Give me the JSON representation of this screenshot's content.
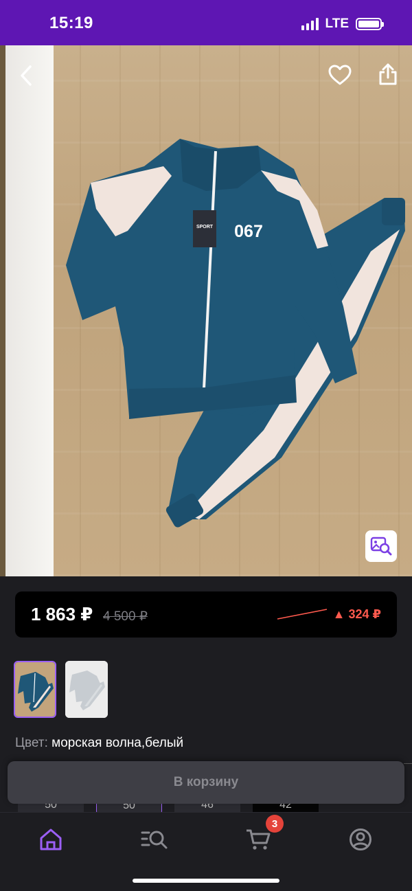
{
  "status_bar": {
    "time": "15:19",
    "network": "LTE"
  },
  "product": {
    "price_current": "1 863 ₽",
    "price_old": "4 500 ₽",
    "price_diff": "▲ 324 ₽",
    "tag_brand": "SPORT",
    "jacket_number": "067",
    "color_label": "Цвет:",
    "color_value": "морская волна,белый"
  },
  "sizes": [
    "50",
    "50",
    "46",
    "42"
  ],
  "actions": {
    "add_to_cart": "В корзину"
  },
  "tab_bar": {
    "cart_badge": "3"
  },
  "colors": {
    "accent": "#5e16b3",
    "price_up": "#ff5a4e",
    "jacket": "#1f5777"
  },
  "icons": [
    "back-icon",
    "heart-icon",
    "share-icon",
    "visual-search-icon",
    "home-icon",
    "catalog-search-icon",
    "cart-icon",
    "profile-icon"
  ]
}
